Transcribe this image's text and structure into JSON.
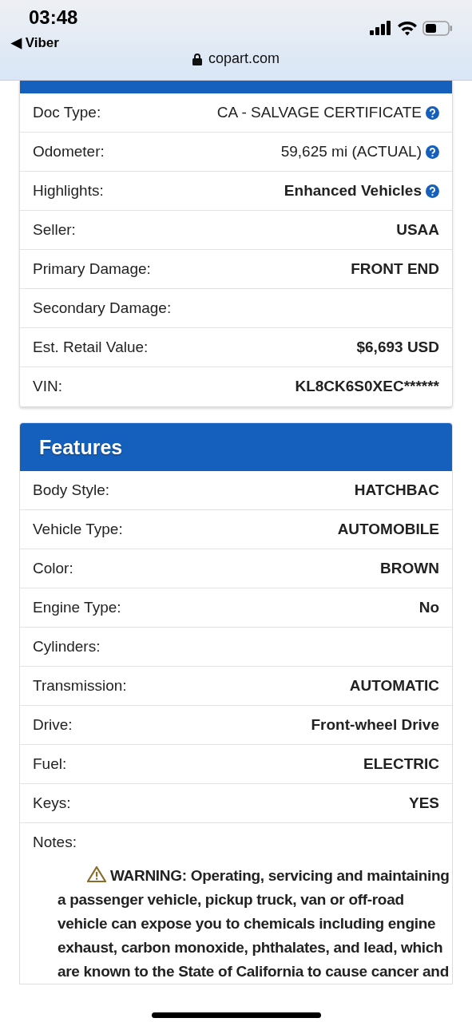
{
  "status_bar": {
    "time": "03:48",
    "back_app": "◀ Viber",
    "url": "copart.com"
  },
  "details": [
    {
      "label": "Doc Type:",
      "value": "CA - SALVAGE CERTIFICATE",
      "emphasis": false,
      "help": true
    },
    {
      "label": "Odometer:",
      "value": "59,625 mi (ACTUAL)",
      "emphasis": false,
      "help": true
    },
    {
      "label": "Highlights:",
      "value": "Enhanced Vehicles",
      "emphasis": true,
      "help": true
    },
    {
      "label": "Seller:",
      "value": "USAA",
      "emphasis": true,
      "help": false
    },
    {
      "label": "Primary Damage:",
      "value": "FRONT END",
      "emphasis": true,
      "help": false
    },
    {
      "label": "Secondary Damage:",
      "help": false
    },
    {
      "label": "Est. Retail Value:",
      "value": "$6,693 USD",
      "emphasis": true,
      "help": false
    },
    {
      "label": "VIN:",
      "value": "KL8CK6S0XEC******",
      "emphasis": true,
      "help": false
    }
  ],
  "features": {
    "title": "Features",
    "rows": [
      {
        "label": "Body Style:",
        "value": "HATCHBAC"
      },
      {
        "label": "Vehicle Type:",
        "value": "AUTOMOBILE"
      },
      {
        "label": "Color:",
        "value": "BROWN"
      },
      {
        "label": "Engine Type:",
        "value": "No"
      },
      {
        "label": "Cylinders:"
      },
      {
        "label": "Transmission:",
        "value": "AUTOMATIC"
      },
      {
        "label": "Drive:",
        "value": "Front-wheel Drive"
      },
      {
        "label": "Fuel:",
        "value": "ELECTRIC"
      },
      {
        "label": "Keys:",
        "value": "YES"
      },
      {
        "label": "Notes:"
      }
    ],
    "warning": "WARNING: Operating, servicing and maintaining a passenger vehicle, pickup truck, van or off-road vehicle can expose you to chemicals including engine exhaust, carbon monoxide, phthalates, and lead, which are known to the State of California to cause cancer and"
  }
}
